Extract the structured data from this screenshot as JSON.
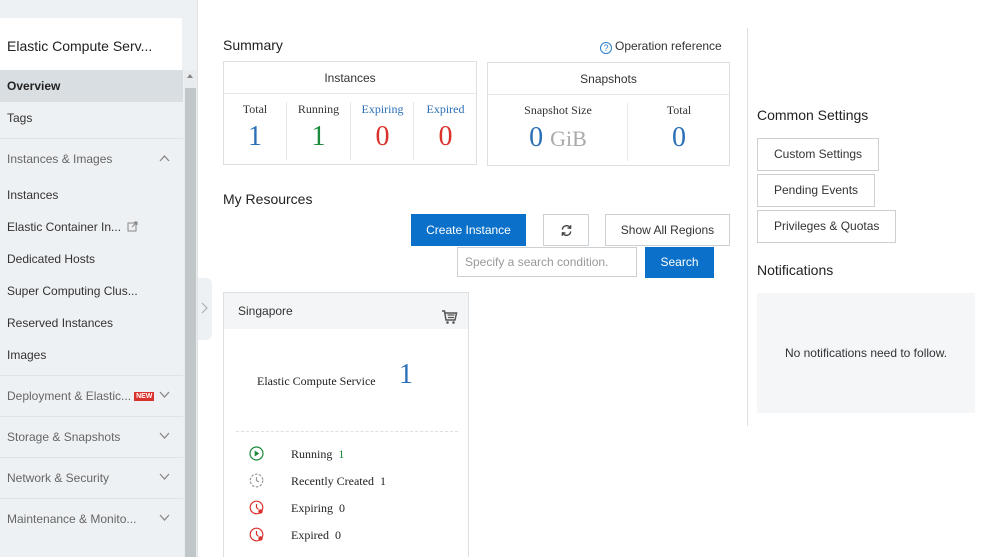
{
  "sidebar": {
    "title": "Elastic Compute Serv...",
    "items": [
      {
        "label": "Overview",
        "active": true
      },
      {
        "label": "Tags"
      }
    ],
    "group_instances": {
      "label": "Instances & Images",
      "items": [
        "Instances",
        "Elastic Container In...",
        "Dedicated Hosts",
        "Super Computing Clus...",
        "Reserved Instances",
        "Images"
      ]
    },
    "groups": [
      {
        "label": "Deployment & Elastic...",
        "badge": "NEW"
      },
      {
        "label": "Storage & Snapshots"
      },
      {
        "label": "Network & Security"
      },
      {
        "label": "Maintenance & Monito..."
      }
    ]
  },
  "summary": {
    "title": "Summary",
    "operation_reference": "Operation reference",
    "instances": {
      "header": "Instances",
      "stats": [
        {
          "label": "Total",
          "value": "1",
          "color": "#2b6fb7"
        },
        {
          "label": "Running",
          "value": "1",
          "color": "#1b8a3b"
        },
        {
          "label": "Expiring",
          "value": "0",
          "color": "#d9322c"
        },
        {
          "label": "Expired",
          "value": "0",
          "color": "#d9322c"
        }
      ]
    },
    "snapshots": {
      "header": "Snapshots",
      "size_label": "Snapshot Size",
      "size_value": "0",
      "size_unit": "GiB",
      "total_label": "Total",
      "total_value": "0"
    }
  },
  "resources": {
    "title": "My Resources",
    "create_button": "Create Instance",
    "show_regions_button": "Show All Regions",
    "search_placeholder": "Specify a search condition.",
    "search_button": "Search",
    "region": {
      "name": "Singapore",
      "service_label": "Elastic Compute Service",
      "service_count": "1",
      "stats": [
        {
          "label": "Running",
          "value": "1",
          "icon": "running-icon"
        },
        {
          "label": "Recently Created",
          "value": "1",
          "icon": "recently-created-icon"
        },
        {
          "label": "Expiring",
          "value": "0",
          "icon": "expiring-icon"
        },
        {
          "label": "Expired",
          "value": "0",
          "icon": "expired-icon"
        }
      ]
    }
  },
  "common_settings": {
    "title": "Common Settings",
    "buttons": [
      "Custom Settings",
      "Pending Events",
      "Privileges & Quotas"
    ]
  },
  "notifications": {
    "title": "Notifications",
    "empty_text": "No notifications need to follow."
  },
  "colors": {
    "primary": "#0a70c9",
    "blue_number": "#2b6fb7",
    "green_number": "#1b8a3b",
    "red_number": "#d9322c"
  }
}
